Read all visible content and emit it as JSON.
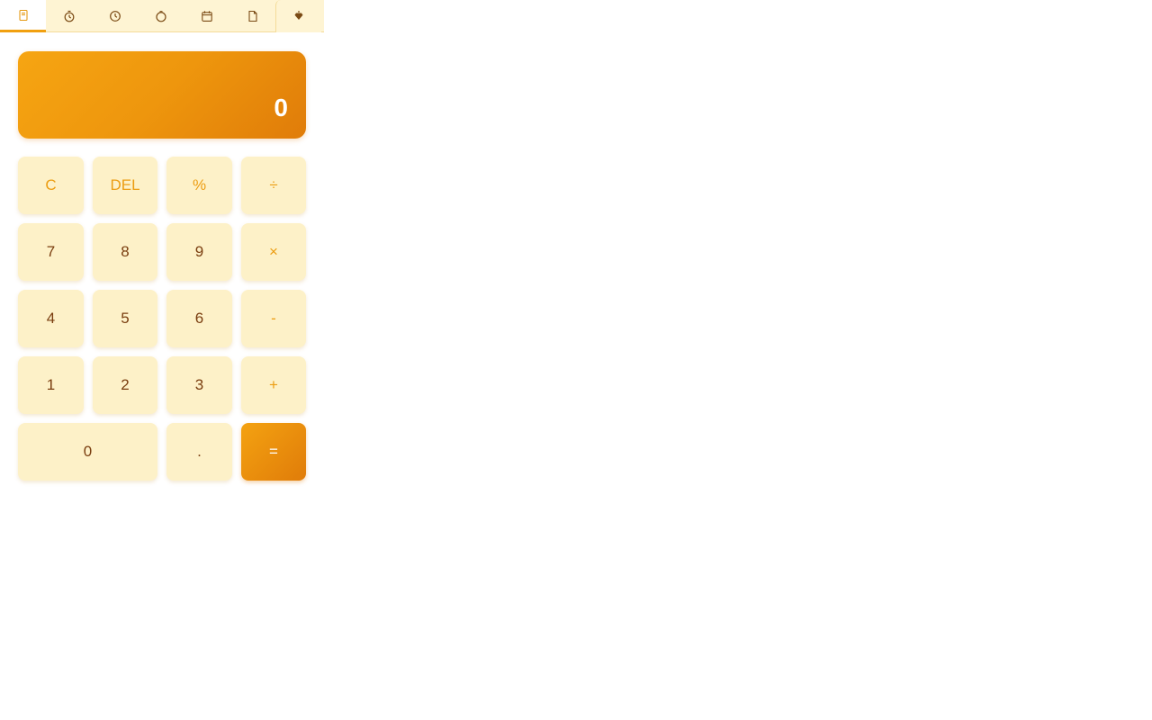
{
  "tabs": [
    {
      "icon": "notebook-icon",
      "active": true
    },
    {
      "icon": "stopwatch-icon",
      "active": false
    },
    {
      "icon": "clock-icon",
      "active": false
    },
    {
      "icon": "timer-icon",
      "active": false
    },
    {
      "icon": "calendar-icon",
      "active": false
    },
    {
      "icon": "document-icon",
      "active": false
    },
    {
      "icon": "diamond-icon",
      "active": false
    }
  ],
  "display": {
    "value": "0"
  },
  "keys": {
    "clear": "C",
    "delete": "DEL",
    "percent": "%",
    "divide": "÷",
    "seven": "7",
    "eight": "8",
    "nine": "9",
    "multiply": "×",
    "four": "4",
    "five": "5",
    "six": "6",
    "subtract": "-",
    "one": "1",
    "two": "2",
    "three": "3",
    "add": "+",
    "zero": "0",
    "decimal": ".",
    "equals": "="
  },
  "colors": {
    "accent": "#f1a00f",
    "accent_dark": "#e07c09",
    "key_background": "#fdf1c8",
    "digit_text": "#7a3e10",
    "tabbar_background": "#fef4d3"
  }
}
